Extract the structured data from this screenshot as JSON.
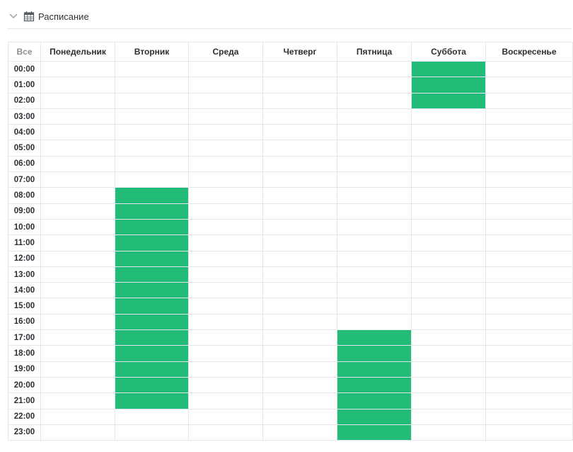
{
  "panel": {
    "title": "Расписание",
    "toggle_icon": "chevron-down-icon",
    "title_icon": "calendar-icon"
  },
  "colors": {
    "active": "#23bb78",
    "grid": "#e3e6ea",
    "muted_header": "#8a8f96"
  },
  "schedule": {
    "all_label": "Все",
    "days": [
      "Понедельник",
      "Вторник",
      "Среда",
      "Четверг",
      "Пятница",
      "Суббота",
      "Воскресенье"
    ],
    "hours": [
      "00:00",
      "01:00",
      "02:00",
      "03:00",
      "04:00",
      "05:00",
      "06:00",
      "07:00",
      "08:00",
      "09:00",
      "10:00",
      "11:00",
      "12:00",
      "13:00",
      "14:00",
      "15:00",
      "16:00",
      "17:00",
      "18:00",
      "19:00",
      "20:00",
      "21:00",
      "22:00",
      "23:00"
    ],
    "active": {
      "Вторник": [
        "08:00",
        "09:00",
        "10:00",
        "11:00",
        "12:00",
        "13:00",
        "14:00",
        "15:00",
        "16:00",
        "17:00",
        "18:00",
        "19:00",
        "20:00",
        "21:00"
      ],
      "Пятница": [
        "17:00",
        "18:00",
        "19:00",
        "20:00",
        "21:00",
        "22:00",
        "23:00"
      ],
      "Суббота": [
        "00:00",
        "01:00",
        "02:00"
      ]
    }
  }
}
